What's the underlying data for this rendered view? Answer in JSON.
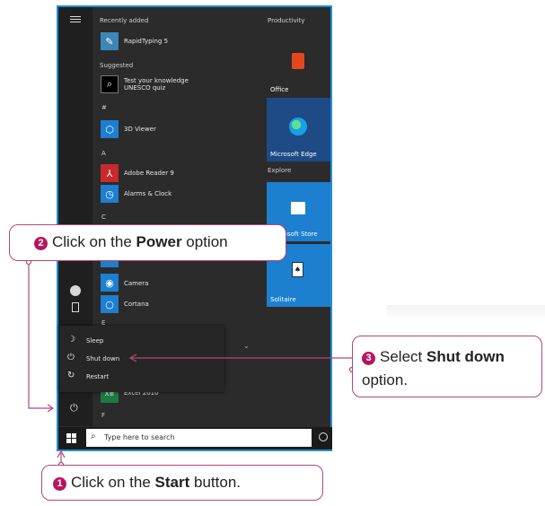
{
  "start_menu": {
    "headers": {
      "recently_added": "Recently added",
      "suggested": "Suggested",
      "hash": "#",
      "a": "A",
      "c": "C",
      "e": "E",
      "f": "F"
    },
    "apps": {
      "rapidtyping": "RapidTyping 5",
      "knowledge_line1": "Test your knowledge",
      "knowledge_line2": "UNESCO quiz",
      "viewer3d": "3D Viewer",
      "adobe": "Adobe Reader 9",
      "alarms": "Alarms & Clock",
      "camera": "Camera",
      "cortana": "Cortana",
      "excel": "Excel 2010"
    },
    "tiles": {
      "productivity": "Productivity",
      "office": "Office",
      "edge": "Microsoft Edge",
      "explore": "Explore",
      "store": "Microsoft Store",
      "solitaire": "Solitaire"
    },
    "power_menu": {
      "sleep": "Sleep",
      "shut_down": "Shut down",
      "restart": "Restart"
    },
    "taskbar": {
      "search_placeholder": "Type here to search"
    }
  },
  "callouts": {
    "step1": {
      "num": "1",
      "pre": "Click on the ",
      "bold": "Start",
      "post": " button."
    },
    "step2": {
      "num": "2",
      "pre": "Click on the ",
      "bold": "Power",
      "post": " option"
    },
    "step3": {
      "num": "3",
      "pre": "Select ",
      "bold": "Shut down",
      "line2": "option."
    }
  },
  "colors": {
    "accent": "#b8155f",
    "callout_border": "#b0487a",
    "frame_blue": "#1f8fd6",
    "edge_tile": "#1e4a86",
    "tile_blue": "#1c7fd0"
  }
}
